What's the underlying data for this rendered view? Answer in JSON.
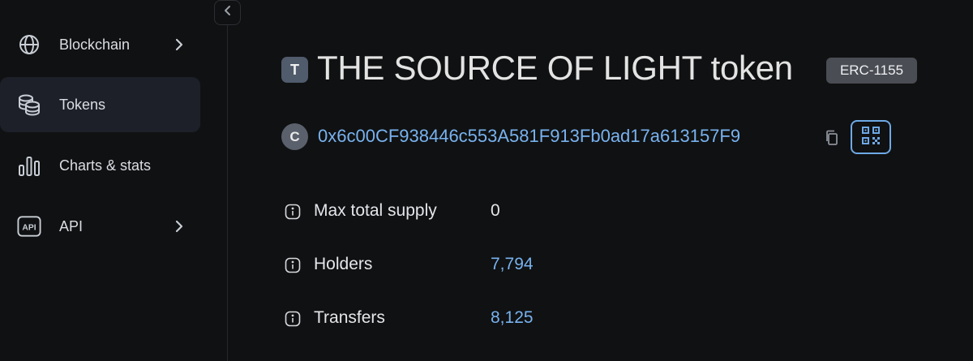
{
  "sidebar": {
    "items": [
      {
        "label": "Blockchain",
        "icon": "globe-icon",
        "has_chevron": true,
        "active": false
      },
      {
        "label": "Tokens",
        "icon": "coins-icon",
        "has_chevron": false,
        "active": true
      },
      {
        "label": "Charts & stats",
        "icon": "bar-chart-icon",
        "has_chevron": false,
        "active": false
      },
      {
        "label": "API",
        "icon": "api-icon",
        "has_chevron": true,
        "active": false
      }
    ]
  },
  "token": {
    "badge_letter": "T",
    "title": "THE SOURCE OF LIGHT token",
    "standard": "ERC-1155",
    "address_letter": "C",
    "address": "0x6c00CF938446c553A581F913Fb0ad17a613157F9"
  },
  "details": [
    {
      "label": "Max total supply",
      "value": "0",
      "is_link": false
    },
    {
      "label": "Holders",
      "value": "7,794",
      "is_link": true
    },
    {
      "label": "Transfers",
      "value": "8,125",
      "is_link": true
    }
  ],
  "colors": {
    "background": "#101112",
    "active_nav": "#1d2029",
    "link": "#78b2ef",
    "badge": "#4a4d53"
  }
}
